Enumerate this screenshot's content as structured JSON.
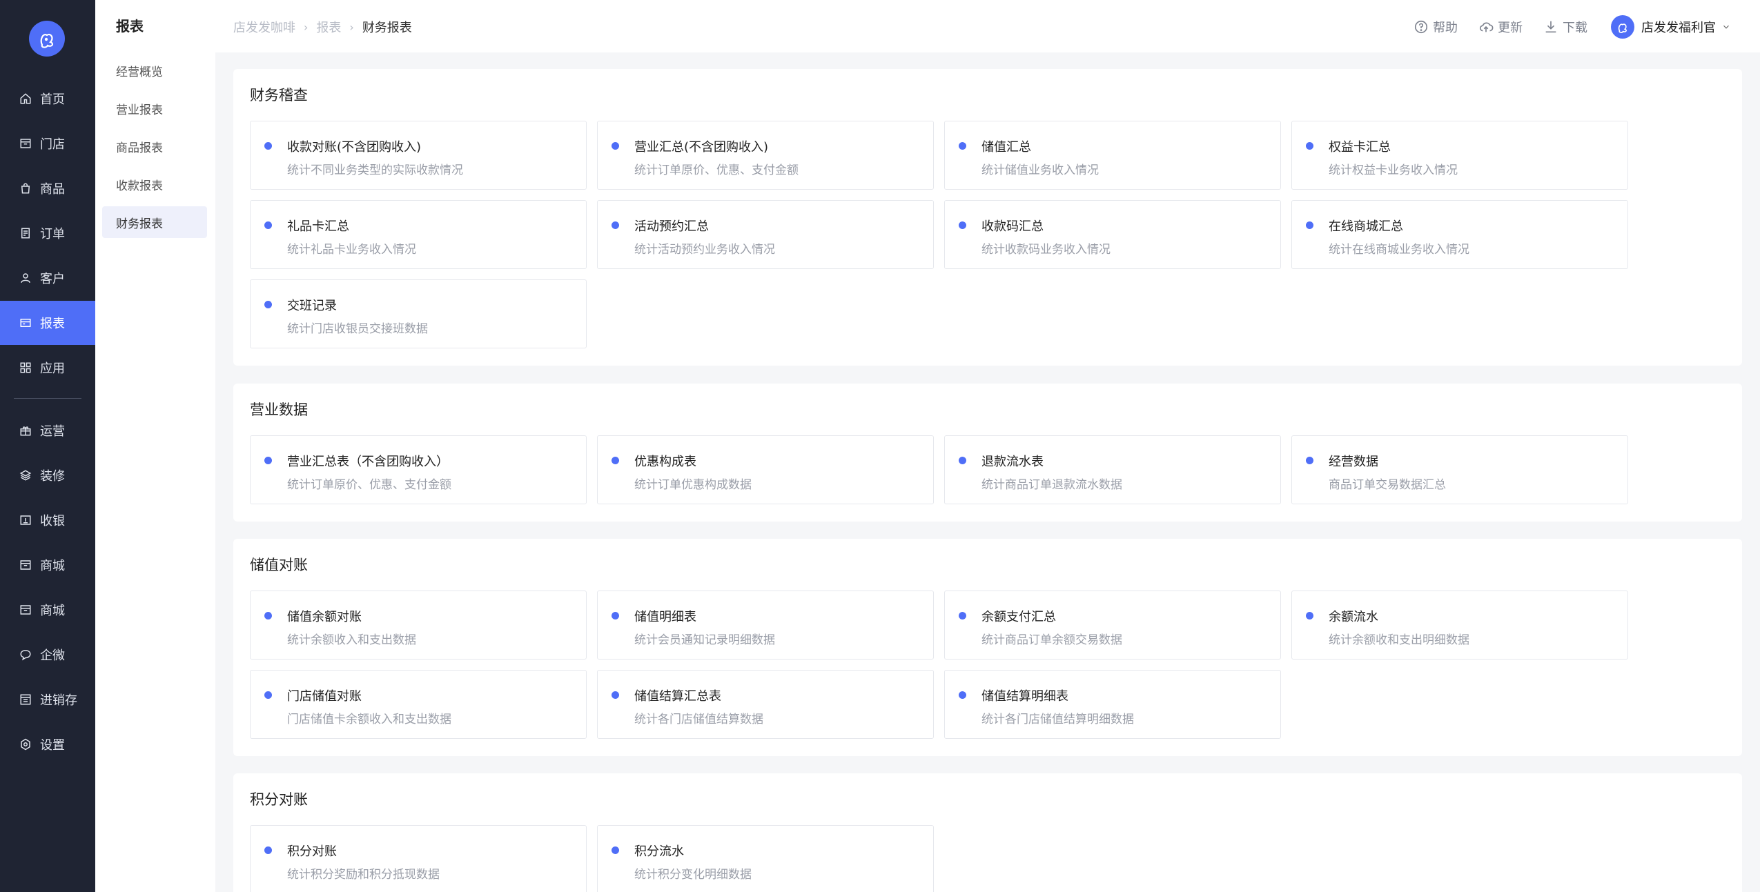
{
  "sidebar": {
    "items": [
      {
        "label": "首页",
        "icon": "home-icon"
      },
      {
        "label": "门店",
        "icon": "store-icon"
      },
      {
        "label": "商品",
        "icon": "bag-icon"
      },
      {
        "label": "订单",
        "icon": "order-icon"
      },
      {
        "label": "客户",
        "icon": "user-icon"
      },
      {
        "label": "报表",
        "icon": "report-icon"
      },
      {
        "label": "应用",
        "icon": "apps-icon"
      },
      {
        "label": "运营",
        "icon": "gift-icon"
      },
      {
        "label": "装修",
        "icon": "layers-icon"
      },
      {
        "label": "收银",
        "icon": "cashier-icon"
      },
      {
        "label": "商城",
        "icon": "shop-icon"
      },
      {
        "label": "商城",
        "icon": "shop-icon"
      },
      {
        "label": "企微",
        "icon": "chat-icon"
      },
      {
        "label": "进销存",
        "icon": "inventory-icon"
      },
      {
        "label": "设置",
        "icon": "settings-icon"
      }
    ],
    "active": "报表"
  },
  "submenu": {
    "title": "报表",
    "items": [
      "经营概览",
      "营业报表",
      "商品报表",
      "收款报表",
      "财务报表"
    ],
    "active": "财务报表"
  },
  "breadcrumb": [
    "店发发咖啡",
    "报表",
    "财务报表"
  ],
  "topbar": {
    "help": "帮助",
    "update": "更新",
    "download": "下载",
    "user": "店发发福利官"
  },
  "sections": [
    {
      "title": "财务稽查",
      "cards": [
        {
          "title": "收款对账(不含团购收入)",
          "desc": "统计不同业务类型的实际收款情况"
        },
        {
          "title": "营业汇总(不含团购收入)",
          "desc": "统计订单原价、优惠、支付金额"
        },
        {
          "title": "储值汇总",
          "desc": "统计储值业务收入情况"
        },
        {
          "title": "权益卡汇总",
          "desc": "统计权益卡业务收入情况"
        },
        {
          "title": "礼品卡汇总",
          "desc": "统计礼品卡业务收入情况"
        },
        {
          "title": "活动预约汇总",
          "desc": "统计活动预约业务收入情况"
        },
        {
          "title": "收款码汇总",
          "desc": "统计收款码业务收入情况"
        },
        {
          "title": "在线商城汇总",
          "desc": "统计在线商城业务收入情况"
        },
        {
          "title": "交班记录",
          "desc": "统计门店收银员交接班数据"
        }
      ]
    },
    {
      "title": "营业数据",
      "cards": [
        {
          "title": "营业汇总表（不含团购收入）",
          "desc": "统计订单原价、优惠、支付金额"
        },
        {
          "title": "优惠构成表",
          "desc": "统计订单优惠构成数据"
        },
        {
          "title": "退款流水表",
          "desc": "统计商品订单退款流水数据"
        },
        {
          "title": "经营数据",
          "desc": "商品订单交易数据汇总"
        }
      ]
    },
    {
      "title": "储值对账",
      "cards": [
        {
          "title": "储值余额对账",
          "desc": "统计余额收入和支出数据"
        },
        {
          "title": "储值明细表",
          "desc": "统计会员通知记录明细数据"
        },
        {
          "title": "余额支付汇总",
          "desc": "统计商品订单余额交易数据"
        },
        {
          "title": "余额流水",
          "desc": "统计余额收和支出明细数据"
        },
        {
          "title": "门店储值对账",
          "desc": "门店储值卡余额收入和支出数据"
        },
        {
          "title": "储值结算汇总表",
          "desc": "统计各门店储值结算数据"
        },
        {
          "title": "储值结算明细表",
          "desc": "统计各门店储值结算明细数据"
        }
      ]
    },
    {
      "title": "积分对账",
      "cards": [
        {
          "title": "积分对账",
          "desc": "统计积分奖励和积分抵现数据"
        },
        {
          "title": "积分流水",
          "desc": "统计积分变化明细数据"
        }
      ]
    }
  ],
  "colors": {
    "accent": "#4f6ef7",
    "sidebar_bg": "#1f2433"
  }
}
